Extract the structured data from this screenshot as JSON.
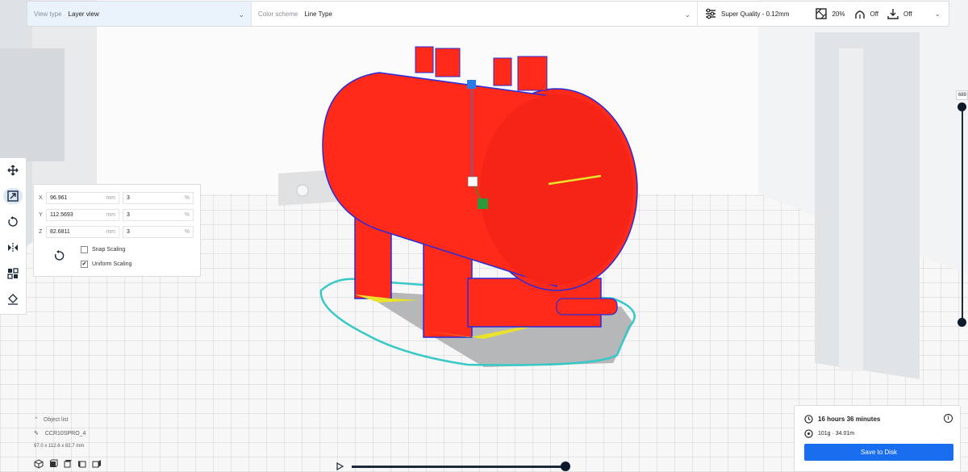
{
  "top_bar": {
    "view_type_label": "View type",
    "view_type_value": "Layer view",
    "color_scheme_label": "Color scheme",
    "color_scheme_value": "Line Type",
    "quality": "Super Quality - 0.12mm",
    "infill": "20%",
    "support": "Off",
    "adhesion": "Off"
  },
  "scale_panel": {
    "x_label": "X",
    "x_value": "96.961",
    "x_unit": "mm",
    "x_percent": "3",
    "pct_unit": "%",
    "y_label": "Y",
    "y_value": "112.5693",
    "y_unit": "mm",
    "y_percent": "3",
    "z_label": "Z",
    "z_value": "82.6811",
    "z_unit": "mm",
    "z_percent": "3",
    "snap_scaling": "Snap Scaling",
    "uniform_scaling": "Uniform Scaling",
    "uniform_checked": "✔"
  },
  "layer_slider": {
    "top_value": "689"
  },
  "object_list": {
    "title": "Object list",
    "item": "CCR10SPRO_4",
    "dimensions": "97.0 x 112.6 x 82.7 mm"
  },
  "print_panel": {
    "time": "16 hours 36 minutes",
    "material": "101g · 34.01m",
    "save_button": "Save to Disk",
    "info_glyph": "i"
  },
  "colors": {
    "accent": "#196ef0",
    "model": "#ff2a1a",
    "outline": "#2b2bd9",
    "skirt": "#38c8c8",
    "infill": "#e9e32a"
  },
  "icons": {
    "move": "move-icon",
    "scale": "scale-icon",
    "rotate": "rotate-icon",
    "mirror": "mirror-icon",
    "per_model": "per-model-settings-icon",
    "support_blocker": "support-blocker-icon"
  }
}
